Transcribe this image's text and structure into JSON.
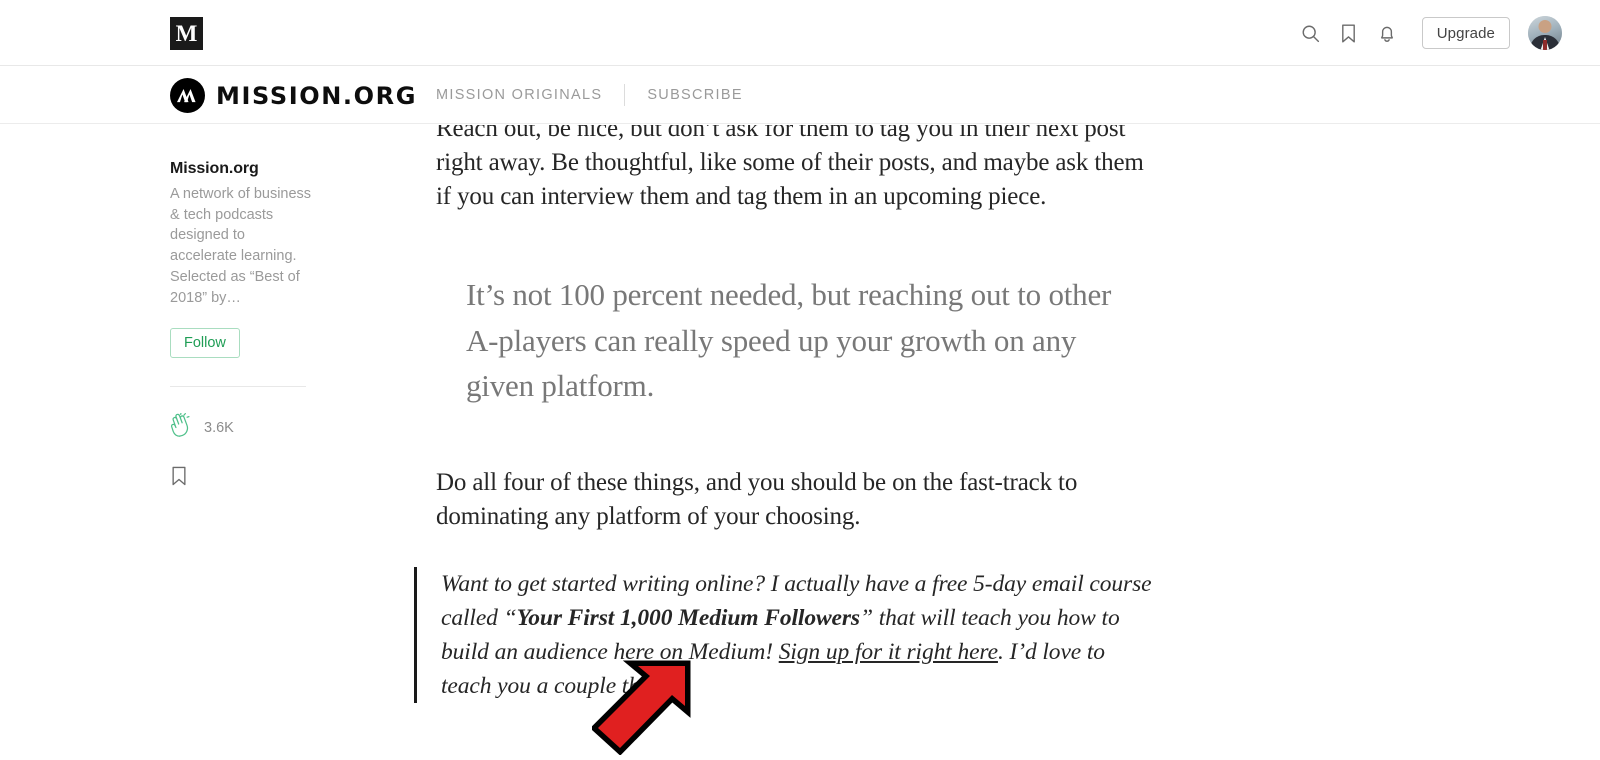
{
  "top_bar": {
    "logo_icon": "medium-m-logo",
    "logo_letter": "M",
    "icons": [
      {
        "name": "search-icon",
        "label": "Search"
      },
      {
        "name": "bookmark-icon",
        "label": "Bookmarks"
      },
      {
        "name": "bell-icon",
        "label": "Notifications"
      }
    ],
    "upgrade_label": "Upgrade",
    "avatar_name": "user-avatar"
  },
  "publication_bar": {
    "logo_icon": "mission-org-mountain-logo",
    "title": "MISSION.ORG",
    "nav": [
      {
        "label": "MISSION ORIGINALS"
      },
      {
        "label": "SUBSCRIBE"
      }
    ]
  },
  "sidebar": {
    "publication_name": "Mission.org",
    "description": "A network of business & tech podcasts designed to accelerate learning. Selected as “Best of 2018” by…",
    "follow_label": "Follow",
    "clap_icon": "clap-icon",
    "clap_count": "3.6K",
    "bookmark_icon": "bookmark-icon"
  },
  "article": {
    "paragraph_1": "Reach out, be nice, but don’t ask for them to tag you in their next post right away. Be thoughtful, like some of their posts, and maybe ask them if you can interview them and tag them in an upcoming piece.",
    "pull_quote": "It’s not 100 percent needed, but reaching out to other A-players can really speed up your growth on any given platform.",
    "paragraph_2": "Do all four of these things, and you should be on the fast-track to dominating any platform of your choosing.",
    "blockquote": {
      "part_1": "Want to get started writing online? I actually have a free 5-day email course called “",
      "bold": "Your First 1,000 Medium Followers",
      "part_2": "” that will teach you how to build an audience here on Medium! ",
      "link": "Sign up for it right here",
      "part_3": ". I’d love to teach you a couple things."
    }
  },
  "annotation": {
    "arrow_icon": "red-arrow-annotation",
    "fill_color": "#e02020",
    "outline_color": "#000000",
    "points_to": "Sign up for it right here"
  },
  "colors": {
    "accent_green": "#1f9d55",
    "text": "#262626",
    "muted": "#9a9a9a",
    "quote": "#787878",
    "annotation_red": "#e02020"
  }
}
